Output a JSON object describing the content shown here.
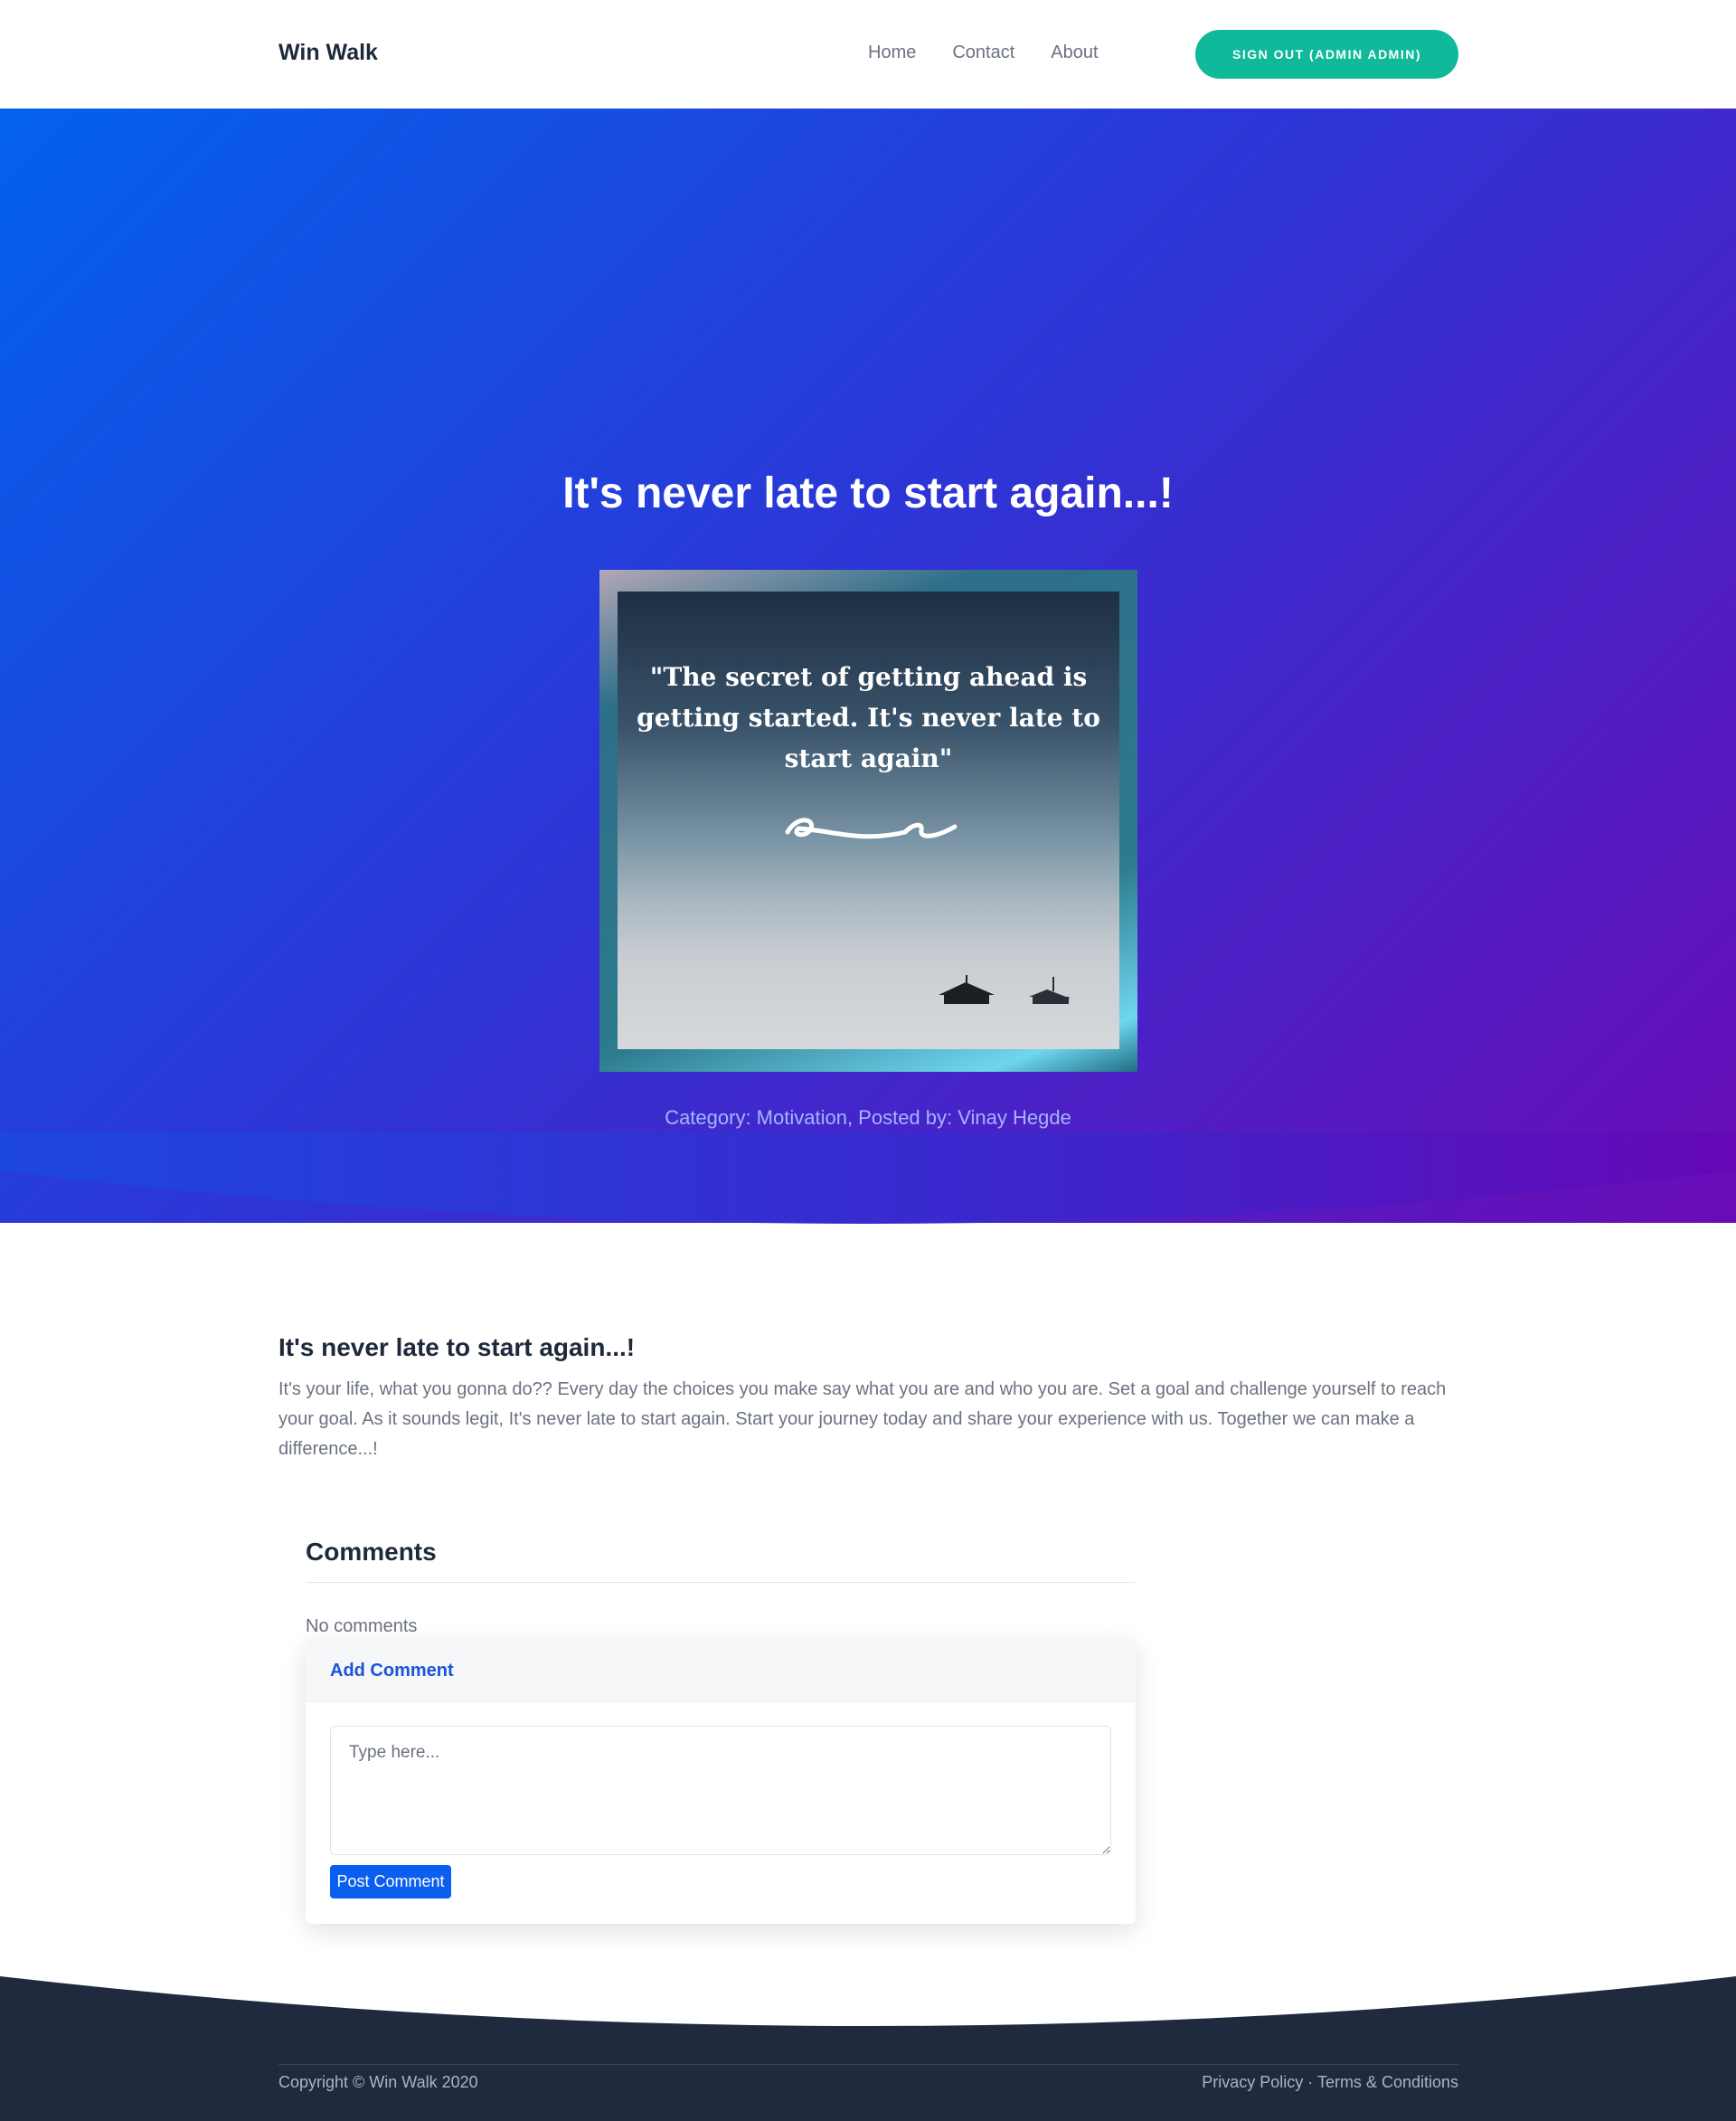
{
  "navbar": {
    "brand": "Win Walk",
    "links": [
      "Home",
      "Contact",
      "About"
    ],
    "signout_label": "Sign Out (Admin Admin)"
  },
  "hero": {
    "title": "It's never late to start again...!",
    "image_quote": "\"The secret of getting ahead is getting started. It's never late to start again\"",
    "meta": "Category: Motivation, Posted by: Vinay Hegde"
  },
  "article": {
    "title": "It's never late to start again...!",
    "body": "It's your life, what you gonna do?? Every day the choices you make say what you are and who you are. Set a goal and challenge yourself to reach your goal. As it sounds legit, It's never late to start again. Start your journey today and share your experience with us. Together we can make a difference...!"
  },
  "comments": {
    "title": "Comments",
    "empty_text": "No comments",
    "add_header": "Add Comment",
    "placeholder": "Type here...",
    "post_label": "Post Comment"
  },
  "footer": {
    "copyright": "Copyright © Win Walk 2020",
    "privacy": "Privacy Policy",
    "separator": " · ",
    "terms": "Terms & Conditions"
  },
  "colors": {
    "accent_green": "#10b99a",
    "primary_blue": "#0a5ff0",
    "hero_gradient_start": "#0362ee",
    "hero_gradient_end": "#6a0cb6",
    "footer_bg": "#1f2a3e"
  }
}
